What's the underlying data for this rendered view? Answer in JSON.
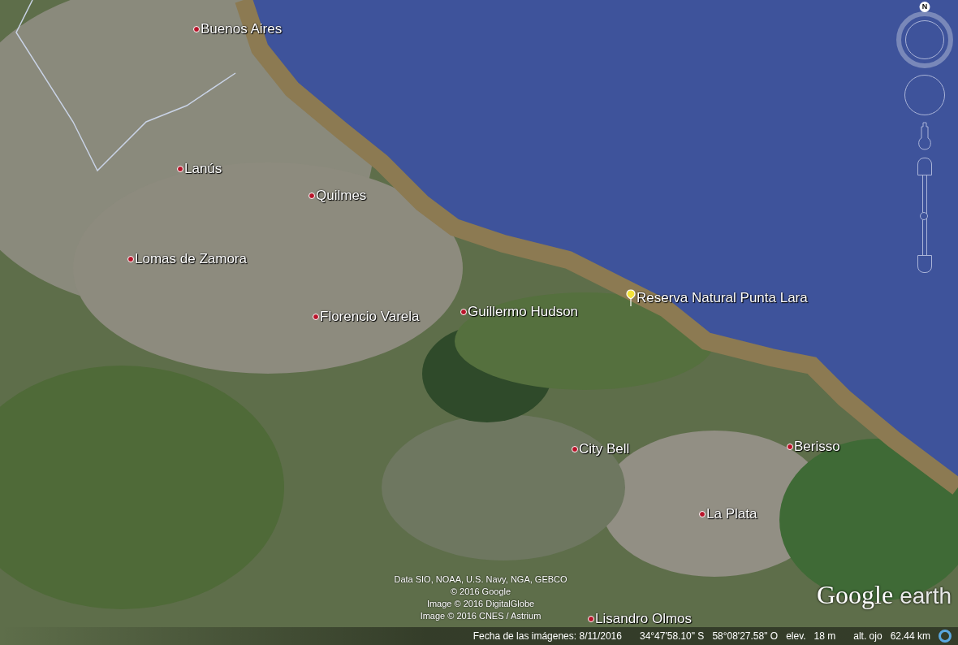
{
  "places": [
    {
      "kind": "town",
      "name": "Buenos Aires"
    },
    {
      "kind": "town",
      "name": "Lanús"
    },
    {
      "kind": "town",
      "name": "Quilmes"
    },
    {
      "kind": "town",
      "name": "Lomas de Zamora"
    },
    {
      "kind": "town",
      "name": "Florencio Varela"
    },
    {
      "kind": "town",
      "name": "Guillermo Hudson"
    },
    {
      "kind": "placemark",
      "name": "Reserva Natural Punta Lara"
    },
    {
      "kind": "town",
      "name": "City Bell"
    },
    {
      "kind": "town",
      "name": "Berisso"
    },
    {
      "kind": "town",
      "name": "La Plata"
    },
    {
      "kind": "town",
      "name": "Lisandro Olmos"
    }
  ],
  "navigation": {
    "north": "N",
    "zoom": {
      "level": 0.5
    }
  },
  "attribution": [
    "Data SIO, NOAA, U.S. Navy, NGA, GEBCO",
    "© 2016 Google",
    "Image © 2016 DigitalGlobe",
    "Image © 2016 CNES / Astrium"
  ],
  "logo": {
    "brand": "Google",
    "product": "earth"
  },
  "status_bar": {
    "imagery_date": "Fecha de las imágenes: 8/11/2016",
    "latitude": "34°47'58.10\" S",
    "longitude": "58°08'27.58\" O",
    "elevation_label": "elev.",
    "elevation": "18 m",
    "eye_altitude_label": "alt. ojo",
    "eye_altitude": "62.44 km"
  }
}
